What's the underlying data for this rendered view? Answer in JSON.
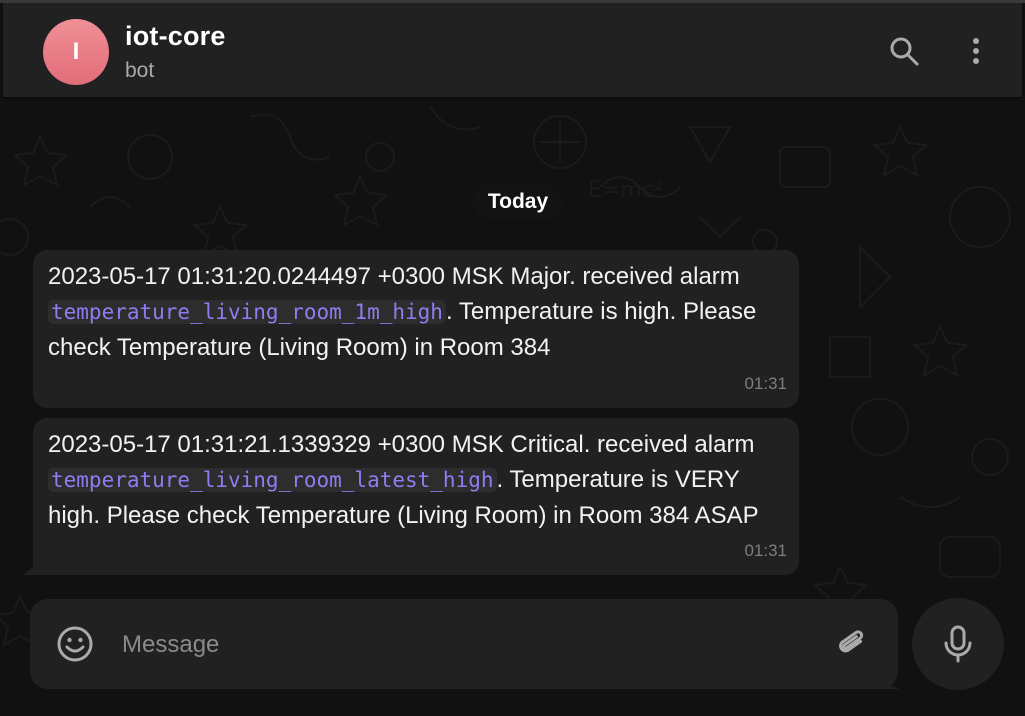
{
  "chat": {
    "avatar_letter": "I",
    "title": "iot-core",
    "subtitle": "bot"
  },
  "header_icons": {
    "search": "search-icon",
    "menu": "more-vertical-icon"
  },
  "date_separator": "Today",
  "messages": [
    {
      "pre": "2023-05-17 01:31:20.0244497 +0300 MSK Major. received alarm ",
      "code": "temperature_living_room_1m_high",
      "post": ". Temperature is high. Please check Temperature (Living Room) in Room 384",
      "time": "01:31"
    },
    {
      "pre": "2023-05-17 01:31:21.1339329 +0300 MSK Critical. received alarm ",
      "code": "temperature_living_room_latest_high",
      "post": ". Temperature is VERY high. Please check Temperature (Living Room) in Room 384 ASAP",
      "time": "01:31"
    }
  ],
  "composer": {
    "placeholder": "Message",
    "emoji_icon": "smile-icon",
    "attach_icon": "paperclip-icon",
    "mic_icon": "microphone-icon"
  },
  "colors": {
    "background": "#111111",
    "panel": "#212121",
    "avatar": "#e6737e",
    "code_text": "#8f7cf2",
    "muted_text": "#aaaaaa"
  }
}
